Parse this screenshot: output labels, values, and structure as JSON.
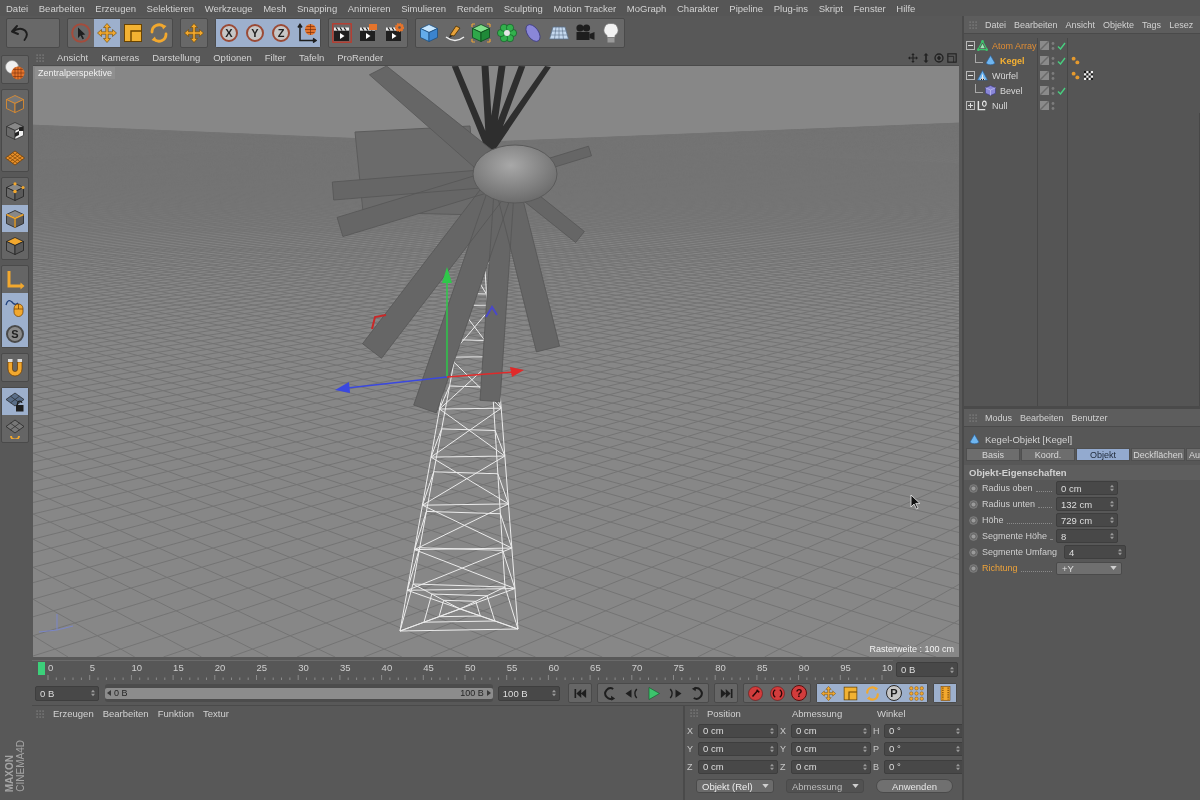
{
  "menu_bar": [
    "Datei",
    "Bearbeiten",
    "Erzeugen",
    "Selektieren",
    "Werkzeuge",
    "Mesh",
    "Snapping",
    "Animieren",
    "Simulieren",
    "Rendern",
    "Sculpting",
    "Motion Tracker",
    "MoGraph",
    "Charakter",
    "Pipeline",
    "Plug-ins",
    "Skript",
    "Fenster",
    "Hilfe"
  ],
  "toolbar": [
    {
      "tools": [
        {
          "kind": "undo",
          "selected": false
        }
      ]
    },
    {
      "tools": [
        {
          "kind": "select",
          "selected": false
        },
        {
          "kind": "move",
          "selected": true
        },
        {
          "kind": "scale",
          "selected": false
        },
        {
          "kind": "rotate",
          "selected": false
        }
      ]
    },
    {
      "tools": [
        {
          "kind": "move",
          "selected": false
        }
      ]
    },
    {
      "tools": [
        {
          "kind": "axis",
          "label": "X",
          "selected": true
        },
        {
          "kind": "axis",
          "label": "Y",
          "selected": true
        },
        {
          "kind": "axis",
          "label": "Z",
          "selected": true
        },
        {
          "kind": "coords",
          "selected": true
        }
      ]
    },
    {
      "tools": [
        {
          "kind": "renderview",
          "selected": false
        },
        {
          "kind": "renderpicture",
          "selected": false
        },
        {
          "kind": "rendersettings",
          "selected": false
        }
      ]
    },
    {
      "tools": [
        {
          "kind": "cube",
          "selected": false
        },
        {
          "kind": "pen",
          "selected": false
        },
        {
          "kind": "subdiv",
          "selected": false
        },
        {
          "kind": "cloner",
          "selected": false
        },
        {
          "kind": "deformer",
          "selected": false
        },
        {
          "kind": "floor",
          "selected": false
        },
        {
          "kind": "camera",
          "selected": false
        },
        {
          "kind": "light",
          "selected": false
        }
      ]
    }
  ],
  "tool_column": [
    {
      "tools": [
        {
          "kind": "editable",
          "selected": false
        }
      ]
    },
    {
      "tools": [
        {
          "kind": "model",
          "selected": false
        },
        {
          "kind": "texture",
          "selected": false
        },
        {
          "kind": "workplane",
          "selected": false
        }
      ]
    },
    {
      "tools": [
        {
          "kind": "points",
          "selected": false
        },
        {
          "kind": "edges",
          "selected": true
        },
        {
          "kind": "polygons",
          "selected": false
        }
      ]
    },
    {
      "tools": [
        {
          "kind": "axismode",
          "selected": false
        },
        {
          "kind": "tweak",
          "selected": true
        },
        {
          "kind": "snap",
          "label": "S",
          "selected": true
        }
      ]
    },
    {
      "tools": [
        {
          "kind": "magnet",
          "selected": false
        }
      ]
    },
    {
      "tools": [
        {
          "kind": "planelock",
          "selected": true
        },
        {
          "kind": "planealign",
          "selected": false
        }
      ]
    }
  ],
  "viewport": {
    "menu": [
      "Ansicht",
      "Kameras",
      "Darstellung",
      "Optionen",
      "Filter",
      "Tafeln",
      "ProRender"
    ],
    "camera": "Zentralperspektive",
    "grid_spacing": "Rasterweite : 100 cm"
  },
  "timeline": {
    "level": 0,
    "ticks": [
      "0",
      "5",
      "10",
      "15",
      "20",
      "25",
      "30",
      "35",
      "40",
      "45",
      "50",
      "55",
      "60",
      "65",
      "70",
      "75",
      "80",
      "85",
      "90",
      "95",
      "10"
    ],
    "current": "0 B"
  },
  "transport": {
    "start": "0 B",
    "range": {
      "start": "0 B",
      "end": "100 B",
      "level": 1
    },
    "end": "100 B",
    "groups": [
      {
        "tools": [
          {
            "kind": "first"
          }
        ]
      },
      {
        "tools": [
          {
            "kind": "prevkey"
          },
          {
            "kind": "prevframe"
          },
          {
            "kind": "play"
          },
          {
            "kind": "nextframe"
          },
          {
            "kind": "nextkey"
          }
        ]
      },
      {
        "tools": [
          {
            "kind": "last"
          }
        ]
      },
      {
        "tools": [
          {
            "kind": "record"
          },
          {
            "kind": "autokey"
          },
          {
            "kind": "keysel",
            "label": "?"
          }
        ]
      },
      {
        "tools": [
          {
            "kind": "keypos",
            "selected": true
          },
          {
            "kind": "keyscale",
            "selected": true
          },
          {
            "kind": "keyrot",
            "selected": true
          },
          {
            "kind": "keyparam",
            "label": "P",
            "selected": true
          },
          {
            "kind": "keypla",
            "selected": true
          }
        ]
      },
      {
        "tools": [
          {
            "kind": "timeline",
            "selected": true
          }
        ]
      }
    ]
  },
  "materials": {
    "menu": [
      "Erzeugen",
      "Bearbeiten",
      "Funktion",
      "Textur"
    ]
  },
  "coordinates": {
    "headers": [
      "Position",
      "Abmessung",
      "Winkel"
    ],
    "rows": [
      [
        {
          "axis": "X",
          "value": "0 cm"
        },
        {
          "axis": "X",
          "value": "0 cm"
        },
        {
          "axis": "H",
          "value": "0 °"
        }
      ],
      [
        {
          "axis": "Y",
          "value": "0 cm"
        },
        {
          "axis": "Y",
          "value": "0 cm"
        },
        {
          "axis": "P",
          "value": "0 °"
        }
      ],
      [
        {
          "axis": "Z",
          "value": "0 cm"
        },
        {
          "axis": "Z",
          "value": "0 cm"
        },
        {
          "axis": "B",
          "value": "0 °"
        }
      ]
    ],
    "mode": {
      "value": "Objekt (Rel)",
      "disabled": false
    },
    "size_mode": {
      "value": "Abmessung",
      "disabled": true
    },
    "apply": "Anwenden"
  },
  "brand": {
    "company": "MAXON",
    "product": "CINEMA4D"
  },
  "object_manager": {
    "menu": [
      "Datei",
      "Bearbeiten",
      "Ansicht",
      "Objekte",
      "Tags",
      "Lesez"
    ],
    "objects": [
      {
        "name": "Atom Array",
        "kind": "atomarray",
        "selected": true,
        "active": false,
        "expanded": true,
        "enabled": true,
        "children": [
          {
            "name": "Kegel",
            "kind": "cone",
            "selected": true,
            "active": true,
            "enabled": true,
            "tags": [
              {
                "kind": "phong"
              }
            ]
          }
        ]
      },
      {
        "name": "Würfel",
        "kind": "cube",
        "selected": false,
        "active": false,
        "expanded": true,
        "enabled": false,
        "tags": [
          {
            "kind": "phong"
          },
          {
            "kind": "texture"
          }
        ],
        "children": [
          {
            "name": "Bevel",
            "kind": "bevel",
            "selected": false,
            "active": false,
            "enabled": true
          }
        ]
      },
      {
        "name": "Null",
        "kind": "null",
        "selected": false,
        "active": false,
        "expanded": false,
        "enabled": false
      }
    ]
  },
  "attributes": {
    "menu": [
      "Modus",
      "Bearbeiten",
      "Benutzer"
    ],
    "title": "Kegel-Objekt [Kegel]",
    "tabs": [
      {
        "label": "Basis",
        "selected": false
      },
      {
        "label": "Koord.",
        "selected": false
      },
      {
        "label": "Objekt",
        "selected": true
      },
      {
        "label": "Deckflächen",
        "selected": false
      },
      {
        "label": "Au",
        "selected": false
      }
    ],
    "section": "Objekt-Eigenschaften",
    "properties": [
      {
        "label": "Radius oben",
        "value": "0 cm",
        "kind": "number",
        "highlighted": false,
        "keyframed": false
      },
      {
        "label": "Radius unten",
        "value": "132 cm",
        "kind": "number",
        "highlighted": false,
        "keyframed": false
      },
      {
        "label": "Höhe",
        "value": "729 cm",
        "kind": "number",
        "highlighted": false,
        "keyframed": false
      },
      {
        "label": "Segmente Höhe",
        "value": "8",
        "kind": "number",
        "highlighted": false,
        "keyframed": false
      },
      {
        "label": "Segmente Umfang",
        "value": "4",
        "kind": "number",
        "highlighted": false,
        "keyframed": false
      },
      {
        "label": "Richtung",
        "value": "+Y",
        "kind": "dropdown",
        "highlighted": true,
        "keyframed": false
      }
    ]
  }
}
